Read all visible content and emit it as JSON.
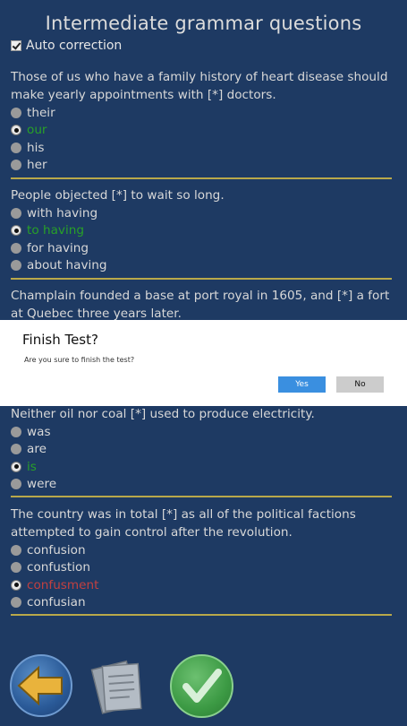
{
  "header": {
    "title": "Intermediate grammar questions"
  },
  "auto_correction": {
    "label": "Auto correction",
    "checked": true
  },
  "questions": [
    {
      "text": "Those of us who have a family history of heart disease should make yearly appointments with [*] doctors.",
      "options": [
        "their",
        "our",
        "his",
        "her"
      ],
      "selected": 1,
      "status": "correct"
    },
    {
      "text": "People objected [*] to wait so long.",
      "options": [
        "with having",
        "to having",
        "for having",
        "about having"
      ],
      "selected": 1,
      "status": "correct"
    },
    {
      "text": "Champlain founded a base at port royal in 1605, and [*] a fort at Quebec three years later.",
      "options": []
    },
    {
      "text": "Neither oil nor coal [*] used to produce electricity.",
      "options": [
        "was",
        "are",
        "is",
        "were"
      ],
      "selected": 2,
      "status": "correct"
    },
    {
      "text": "The country was in total [*] as all of the political factions attempted to gain control after the revolution.",
      "options": [
        "confusion",
        "confustion",
        "confusment",
        "confusian"
      ],
      "selected": 2,
      "status": "wrong"
    }
  ],
  "dialog": {
    "title": "Finish Test?",
    "message": "Are you sure to finish the test?",
    "yes_label": "Yes",
    "no_label": "No"
  },
  "toolbar": {
    "back_icon": "back-arrow-icon",
    "documents_icon": "documents-icon",
    "finish_icon": "checkmark-icon"
  },
  "colors": {
    "background": "#1e3a63",
    "separator": "#b9a84a",
    "correct": "#28a028",
    "wrong": "#c14040",
    "accent": "#3a8fe0"
  }
}
